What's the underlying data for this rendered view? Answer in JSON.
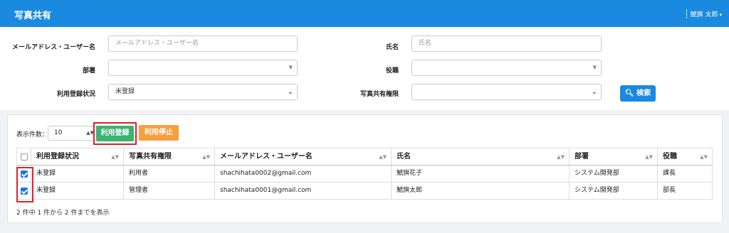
{
  "header": {
    "title": "写真共有",
    "user_name": "鯱旗 太郎"
  },
  "search": {
    "email_label": "メールアドレス・ユーザー名",
    "email_placeholder": "メールアドレス・ユーザー名",
    "name_label": "氏名",
    "name_placeholder": "氏名",
    "dept_label": "部署",
    "role_label": "役職",
    "status_label": "利用登録状況",
    "status_value": "未登録",
    "perm_label": "写真共有権限",
    "search_button": "検索"
  },
  "results": {
    "per_page_label": "表示件数：",
    "per_page_value": "10",
    "register_button": "利用登録",
    "stop_button": "利用停止",
    "columns": [
      "利用登録状況",
      "写真共有権限",
      "メールアドレス・ユーザー名",
      "氏名",
      "部署",
      "役職"
    ],
    "rows": [
      {
        "checked": true,
        "status": "未登録",
        "permission": "利用者",
        "email": "shachihata0002@gmail.com",
        "name": "鯱旗花子",
        "dept": "システム開発部",
        "role": "課長"
      },
      {
        "checked": true,
        "status": "未登録",
        "permission": "管理者",
        "email": "shachihata0001@gmail.com",
        "name": "鯱旗太郎",
        "dept": "システム開発部",
        "role": "部長"
      }
    ],
    "summary": "2 件中 1 件から 2 件までを表示"
  },
  "colors": {
    "header": "#1a8ae0",
    "register": "#3cb371",
    "stop": "#f5a03c",
    "highlight": "#e0202a"
  }
}
